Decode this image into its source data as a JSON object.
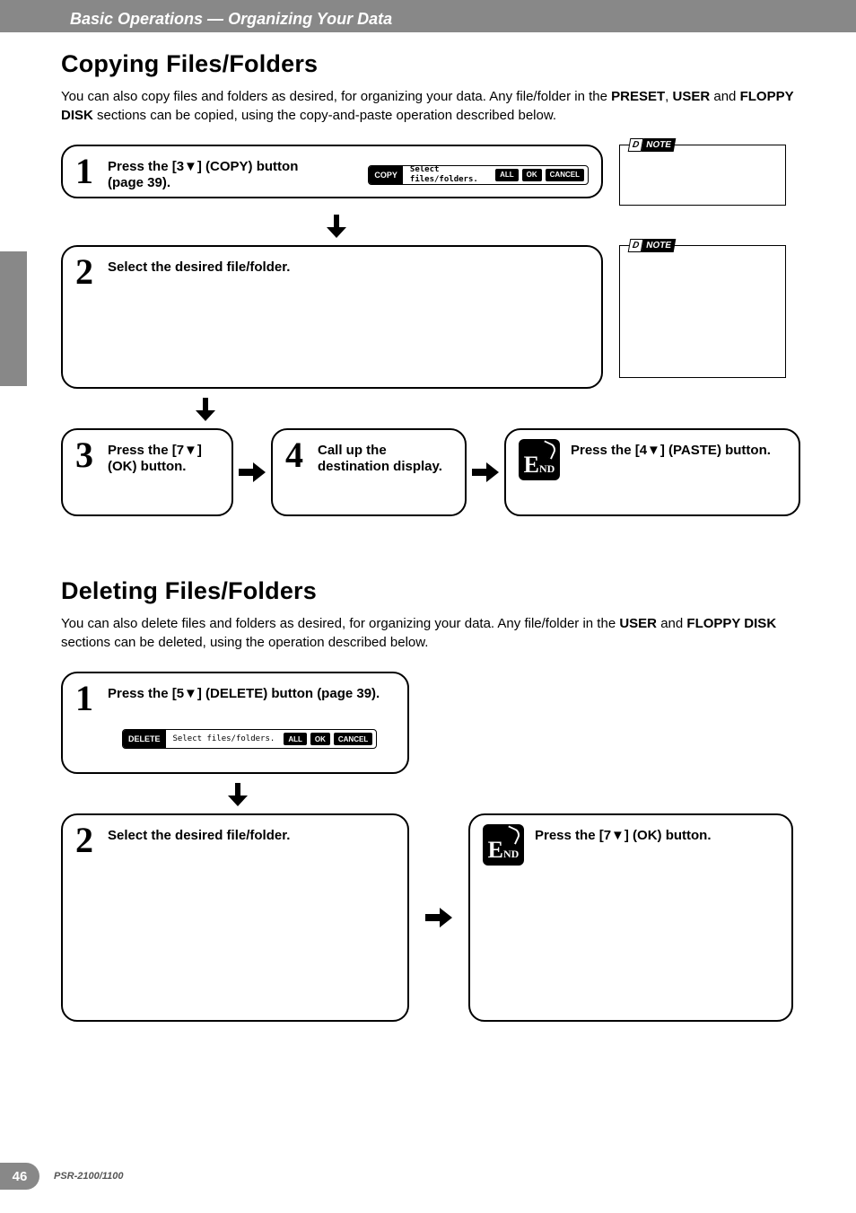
{
  "header": {
    "breadcrumb_prefix": "Basic Operations — ",
    "breadcrumb_suffix": "Organizing Your Data"
  },
  "section1": {
    "title": "Copying Files/Folders",
    "intro_before_preset": "You can also copy files and folders as desired, for organizing your data. Any file/folder in the ",
    "preset": "PRESET",
    "intro_between1": ", ",
    "user": "USER",
    "intro_between2": " and ",
    "floppy": "FLOPPY DISK",
    "intro_after": " sections can be copied, using the copy-and-paste operation described below.",
    "note_badge_left": "D",
    "note_badge_right": "NOTE",
    "widget_copy_mode": "COPY",
    "widget_msg": "Select files/folders.",
    "widget_all": "ALL",
    "widget_ok": "OK",
    "widget_cancel": "CANCEL",
    "step1_num": "1",
    "step1_text": "Press the [3▼] (COPY) button (page 39).",
    "step2_num": "2",
    "step2_text": "Select the desired file/folder.",
    "step3_num": "3",
    "step3_text": "Press the [7▼] (OK) button.",
    "step4_num": "4",
    "step4_text": "Call up the destination display.",
    "end_text": "Press the [4▼] (PASTE) button."
  },
  "section2": {
    "title": "Deleting Files/Folders",
    "intro_before_user": "You can also delete files and folders as desired, for organizing your data. Any file/folder in the ",
    "user": "USER",
    "intro_between": " and ",
    "floppy": "FLOPPY DISK",
    "intro_after": " sections can be deleted, using the operation described below.",
    "widget_delete_mode": "DELETE",
    "widget_msg": "Select files/folders.",
    "widget_all": "ALL",
    "widget_ok": "OK",
    "widget_cancel": "CANCEL",
    "step1_num": "1",
    "step1_text": "Press the [5▼] (DELETE) button (page 39).",
    "step2_num": "2",
    "step2_text": "Select the desired file/folder.",
    "end_text": "Press the [7▼] (OK) button."
  },
  "end_badge": {
    "e": "E",
    "nd": "ND"
  },
  "footer": {
    "page": "46",
    "model": "PSR-2100/1100"
  }
}
